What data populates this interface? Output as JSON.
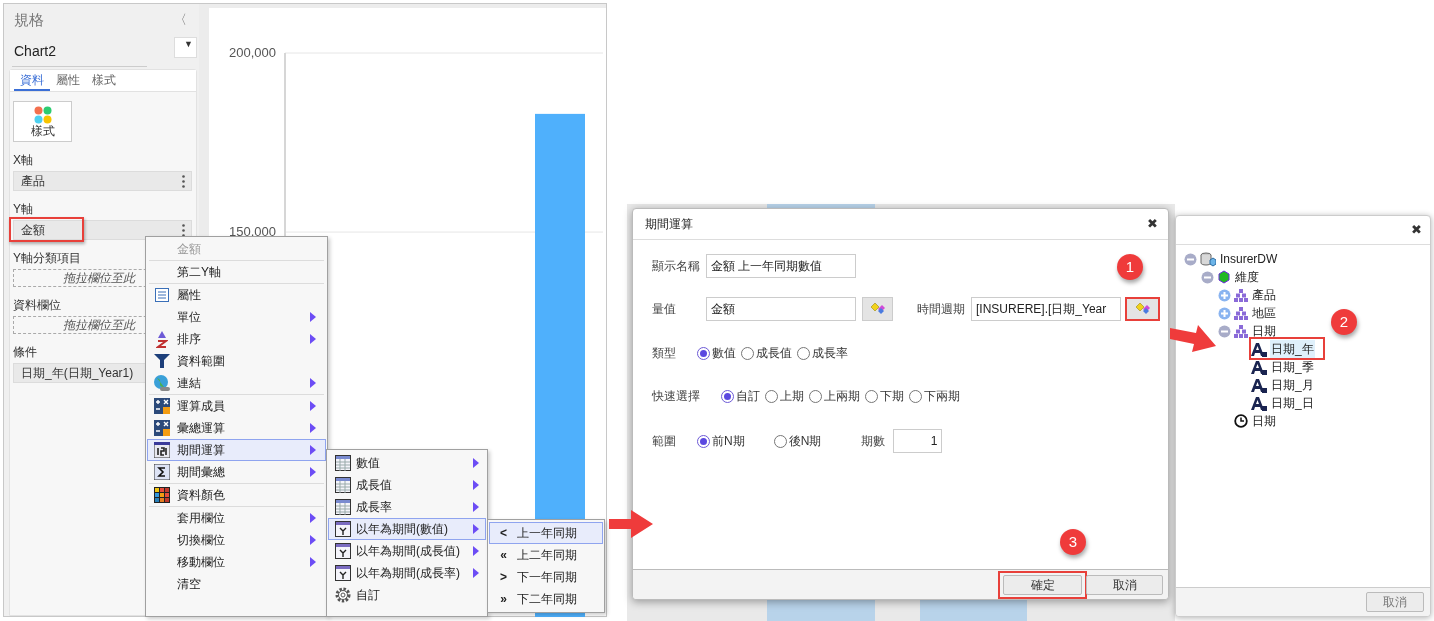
{
  "sidebar": {
    "title": "規格",
    "collapse": "〈",
    "chart_name": "Chart2",
    "dropdown": "▼",
    "tabs": [
      {
        "label": "資料",
        "selected": true
      },
      {
        "label": "屬性",
        "selected": false
      },
      {
        "label": "樣式",
        "selected": false
      }
    ],
    "style_button": "樣式",
    "fields": [
      {
        "kind": "field",
        "label": "X軸",
        "value": "產品",
        "highlighted": false
      },
      {
        "kind": "field",
        "label": "Y軸",
        "value": "金額",
        "highlighted": true
      },
      {
        "kind": "dropzone",
        "label": "Y軸分類項目",
        "placeholder": "拖拉欄位至此",
        "highlighted": false
      },
      {
        "kind": "dropzone",
        "label": "資料欄位",
        "placeholder": "拖拉欄位至此",
        "highlighted": false
      },
      {
        "kind": "field",
        "label": "條件",
        "value": "日期_年(日期_Year1)",
        "highlighted": false
      }
    ]
  },
  "chart": {
    "chart_data": {
      "type": "bar",
      "values": [
        183000
      ],
      "ylim": [
        42500,
        200000
      ],
      "yticks": [
        {
          "value": 150000,
          "label": "150,000"
        },
        {
          "value": 200000,
          "label": "200,000"
        }
      ]
    }
  },
  "context_menu": {
    "groups": [
      [
        {
          "label": "金額",
          "disabled": true,
          "submenu": false,
          "selected": false
        }
      ],
      [
        {
          "label": "第二Y軸",
          "disabled": false,
          "submenu": false,
          "selected": false
        }
      ],
      [
        {
          "label": "屬性",
          "disabled": false,
          "submenu": false,
          "selected": false
        },
        {
          "label": "單位",
          "disabled": false,
          "submenu": true,
          "selected": false
        },
        {
          "label": "排序",
          "disabled": false,
          "submenu": true,
          "selected": false
        },
        {
          "label": "資料範圍",
          "disabled": false,
          "submenu": false,
          "selected": false
        },
        {
          "label": "連結",
          "disabled": false,
          "submenu": true,
          "selected": false
        }
      ],
      [
        {
          "label": "運算成員",
          "disabled": false,
          "submenu": true,
          "selected": false
        },
        {
          "label": "彙總運算",
          "disabled": false,
          "submenu": true,
          "selected": false
        },
        {
          "label": "期間運算",
          "disabled": false,
          "submenu": true,
          "selected": true
        },
        {
          "label": "期間彙總",
          "disabled": false,
          "submenu": true,
          "selected": false
        }
      ],
      [
        {
          "label": "資料顏色",
          "disabled": false,
          "submenu": false,
          "selected": false
        }
      ],
      [
        {
          "label": "套用欄位",
          "disabled": false,
          "submenu": true,
          "selected": false
        },
        {
          "label": "切換欄位",
          "disabled": false,
          "submenu": true,
          "selected": false
        },
        {
          "label": "移動欄位",
          "disabled": false,
          "submenu": true,
          "selected": false
        },
        {
          "label": "清空",
          "disabled": false,
          "submenu": false,
          "selected": false
        }
      ]
    ]
  },
  "period_submenu": {
    "items": [
      {
        "label": "數值",
        "submenu": true,
        "selected": false
      },
      {
        "label": "成長值",
        "submenu": true,
        "selected": false
      },
      {
        "label": "成長率",
        "submenu": true,
        "selected": false
      },
      {
        "label": "以年為期間(數值)",
        "submenu": true,
        "selected": true
      },
      {
        "label": "以年為期間(成長值)",
        "submenu": true,
        "selected": false
      },
      {
        "label": "以年為期間(成長率)",
        "submenu": true,
        "selected": false
      },
      {
        "label": "自訂",
        "submenu": false,
        "selected": false
      }
    ]
  },
  "year_submenu": {
    "items": [
      {
        "symbol": "<",
        "label": "上一年同期",
        "selected": true
      },
      {
        "symbol": "«",
        "label": "上二年同期",
        "selected": false
      },
      {
        "symbol": ">",
        "label": "下一年同期",
        "selected": false
      },
      {
        "symbol": "»",
        "label": "下二年同期",
        "selected": false
      }
    ]
  },
  "dialog": {
    "title": "期間運算",
    "close": "✖",
    "display_name": {
      "label": "顯示名稱",
      "value": "金額 上一年同期數值"
    },
    "measure": {
      "label": "量值",
      "value": "金額"
    },
    "time_period": {
      "label": "時間週期",
      "value": "[INSURERE].[日期_Year",
      "highlighted": true
    },
    "type": {
      "label": "類型",
      "options": [
        {
          "label": "數值",
          "selected": true
        },
        {
          "label": "成長值",
          "selected": false
        },
        {
          "label": "成長率",
          "selected": false
        }
      ]
    },
    "quick_select": {
      "label": "快速選擇",
      "options": [
        {
          "label": "自訂",
          "selected": true
        },
        {
          "label": "上期",
          "selected": false
        },
        {
          "label": "上兩期",
          "selected": false
        },
        {
          "label": "下期",
          "selected": false
        },
        {
          "label": "下兩期",
          "selected": false
        }
      ]
    },
    "range": {
      "label": "範圍",
      "options": [
        {
          "label": "前N期",
          "selected": true
        },
        {
          "label": "後N期",
          "selected": false
        }
      ],
      "count_label": "期數",
      "count": "1"
    },
    "buttons": [
      {
        "label": "確定",
        "highlighted": true
      },
      {
        "label": "取消",
        "highlighted": false
      }
    ]
  },
  "tree_dialog": {
    "close": "✖",
    "tree": [
      {
        "label": "InsurerDW",
        "kind": "database",
        "expanded": true,
        "selected": false,
        "children": [
          {
            "label": "維度",
            "kind": "dimensions",
            "expanded": true,
            "selected": false,
            "children": [
              {
                "label": "產品",
                "kind": "hierarchy",
                "expanded": false,
                "selected": false
              },
              {
                "label": "地區",
                "kind": "hierarchy",
                "expanded": false,
                "selected": false
              },
              {
                "label": "日期",
                "kind": "hierarchy",
                "expanded": true,
                "selected": false,
                "children": [
                  {
                    "label": "日期_年",
                    "kind": "level",
                    "selected": true
                  },
                  {
                    "label": "日期_季",
                    "kind": "level",
                    "selected": false
                  },
                  {
                    "label": "日期_月",
                    "kind": "level",
                    "selected": false
                  },
                  {
                    "label": "日期_日",
                    "kind": "level",
                    "selected": false
                  }
                ]
              },
              {
                "label": "日期",
                "kind": "time",
                "selected": false
              }
            ]
          }
        ]
      }
    ],
    "buttons": [
      {
        "label": "取消"
      }
    ]
  },
  "badges": [
    {
      "label": "1"
    },
    {
      "label": "2"
    },
    {
      "label": "3"
    }
  ]
}
